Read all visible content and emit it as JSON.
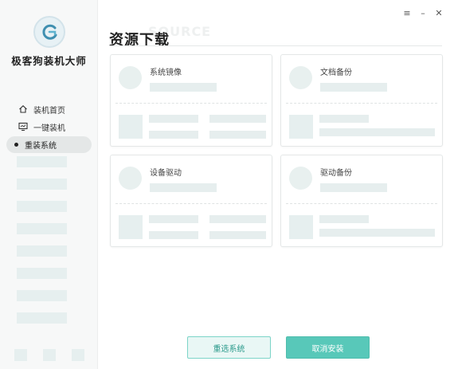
{
  "app": {
    "name": "极客狗装机大师"
  },
  "window_controls": {
    "menu": "≡",
    "minimize": "–",
    "close": "✕"
  },
  "sidebar": {
    "items": [
      {
        "label": "装机首页",
        "icon": "home-icon"
      },
      {
        "label": "一键装机",
        "icon": "monitor-icon"
      }
    ],
    "active_sub": {
      "label": "重装系统"
    }
  },
  "main": {
    "title": "资源下载",
    "title_ghost": "SOURCE",
    "cards": [
      {
        "label": "系统镜像"
      },
      {
        "label": "文档备份"
      },
      {
        "label": "设备驱动"
      },
      {
        "label": "驱动备份"
      }
    ]
  },
  "buttons": {
    "reselect": "重选系统",
    "cancel": "取消安装"
  },
  "colors": {
    "accent": "#58c8b9",
    "skeleton": "#e6eeee",
    "sidebar_bg": "#f7f8f8"
  }
}
